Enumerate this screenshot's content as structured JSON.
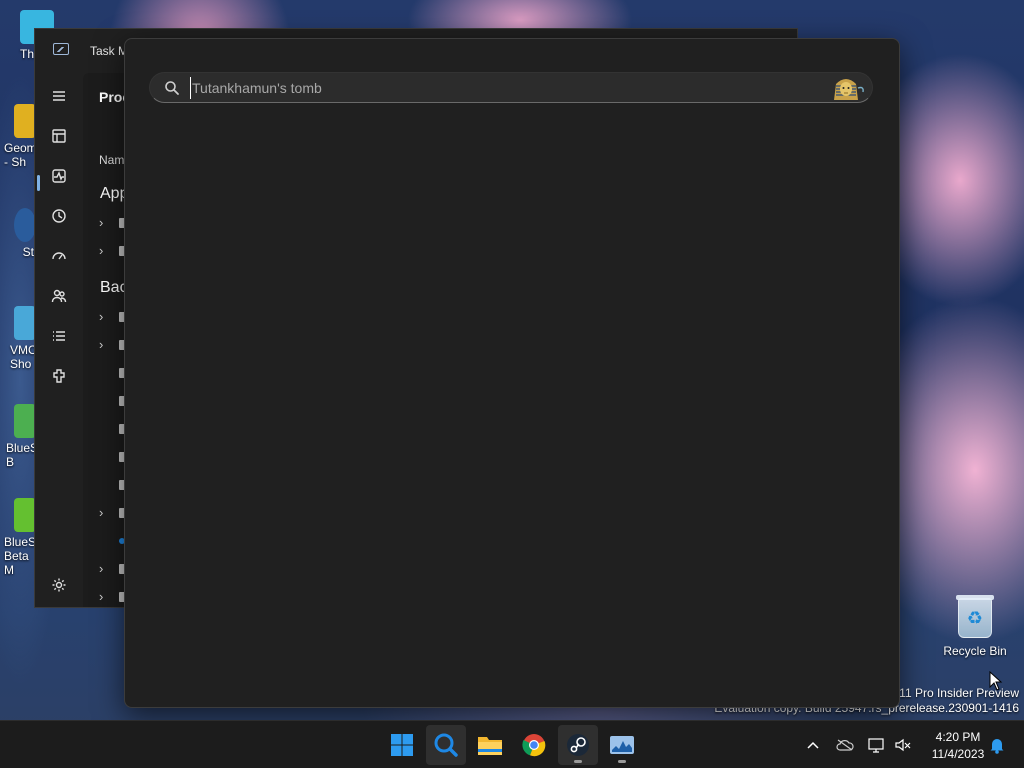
{
  "desktop": {
    "icons": [
      {
        "label": "Th",
        "color": "#38b6e0"
      },
      {
        "label": "Geom - Sh",
        "color": "#e0b020"
      },
      {
        "label": "St",
        "color": "#2a5c9c"
      },
      {
        "label": "VMC Sho",
        "color": "#49a8d8"
      },
      {
        "label": "BlueS B",
        "color": "#4caf50"
      },
      {
        "label": "BlueS Beta M",
        "color": "#64c030"
      }
    ],
    "recycle_bin_label": "Recycle Bin",
    "watermark_line1": "11 Pro Insider Preview",
    "watermark_line2": "Evaluation copy. Build 25947.rs_prerelease.230901-1416"
  },
  "task_manager": {
    "title": "Task M",
    "heading": "Proc",
    "column_header": "Nam",
    "section_apps": "App",
    "section_background": "Bac",
    "nav_icons": [
      "hamburger-icon",
      "processes-icon",
      "performance-icon",
      "app-history-icon",
      "startup-apps-icon",
      "users-icon",
      "details-icon",
      "services-icon",
      "settings-icon"
    ]
  },
  "search": {
    "placeholder": "Tutankhamun's tomb",
    "value": "",
    "highlight_icon": "pharaoh-mask-icon"
  },
  "taskbar": {
    "apps": [
      {
        "name": "start-button",
        "icon": "windows-logo-icon"
      },
      {
        "name": "search-button",
        "icon": "search-icon",
        "active": true
      },
      {
        "name": "file-explorer-button",
        "icon": "folder-icon"
      },
      {
        "name": "chrome-button",
        "icon": "chrome-icon"
      },
      {
        "name": "steam-button",
        "icon": "steam-icon",
        "running": true
      },
      {
        "name": "task-manager-button",
        "icon": "task-manager-icon",
        "running": true
      }
    ],
    "tray_icons": [
      "chevron-up-icon",
      "onedrive-icon",
      "network-icon",
      "volume-muted-icon"
    ],
    "time": "4:20 PM",
    "date": "11/4/2023",
    "notification_icon": "bell-icon"
  },
  "colors": {
    "accent": "#7fb2e5",
    "panel_bg": "#202020",
    "search_box_bg": "#2c2c2c",
    "taskbar_bg": "#1c1c1c"
  }
}
